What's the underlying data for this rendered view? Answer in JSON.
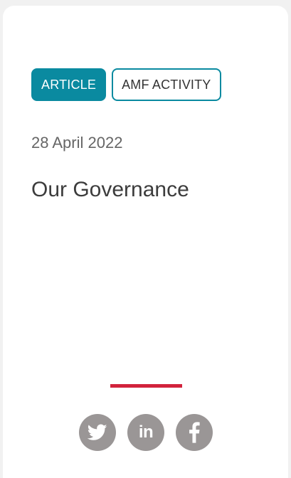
{
  "card": {
    "tags": [
      {
        "label": "ARTICLE",
        "style": "filled"
      },
      {
        "label": "AMF ACTIVITY",
        "style": "outline"
      }
    ],
    "date": "28 April 2022",
    "title": "Our Governance"
  },
  "social": {
    "items": [
      {
        "icon": "twitter-icon"
      },
      {
        "icon": "linkedin-icon",
        "glyph": "in"
      },
      {
        "icon": "facebook-icon"
      }
    ]
  },
  "colors": {
    "accent_teal": "#0a8aa0",
    "divider_red": "#d2233c",
    "social_grey": "#9a9696",
    "page_bg": "#f1f1f1"
  }
}
